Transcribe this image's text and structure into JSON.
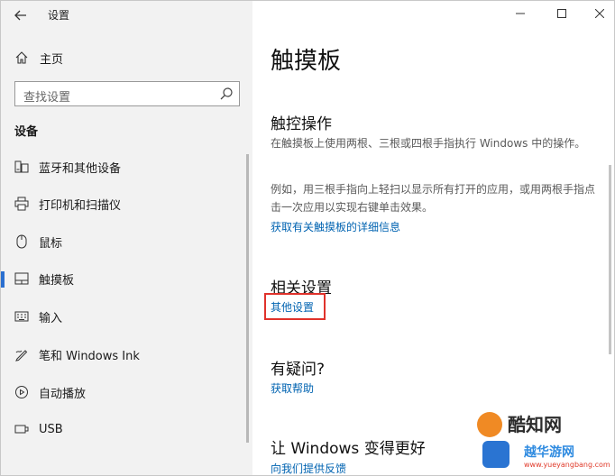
{
  "window": {
    "title": "设置"
  },
  "sidebar": {
    "home_label": "主页",
    "search_placeholder": "查找设置",
    "section_label": "设备",
    "items": [
      {
        "label": "蓝牙和其他设备",
        "icon": "bluetooth-devices-icon"
      },
      {
        "label": "打印机和扫描仪",
        "icon": "printer-icon"
      },
      {
        "label": "鼠标",
        "icon": "mouse-icon"
      },
      {
        "label": "触摸板",
        "icon": "touchpad-icon",
        "selected": true
      },
      {
        "label": "输入",
        "icon": "keyboard-icon"
      },
      {
        "label": "笔和 Windows Ink",
        "icon": "pen-icon"
      },
      {
        "label": "自动播放",
        "icon": "autoplay-icon"
      },
      {
        "label": "USB",
        "icon": "usb-icon"
      }
    ]
  },
  "main": {
    "title": "触摸板",
    "touch_section": {
      "heading": "触控操作",
      "desc1": "在触摸板上使用两根、三根或四根手指执行 Windows 中的操作。",
      "desc2": "例如，用三根手指向上轻扫以显示所有打开的应用，或用两根手指点击一次应用以实现右键单击效果。",
      "link": "获取有关触摸板的详细信息"
    },
    "related": {
      "heading": "相关设置",
      "link": "其他设置"
    },
    "question": {
      "heading": "有疑问?",
      "link": "获取帮助"
    },
    "improve": {
      "heading": "让 Windows 变得更好",
      "link": "向我们提供反馈"
    }
  },
  "watermark": {
    "line1": "酷知网",
    "line2": "越华游网",
    "line3": "www.yueyangbang.com"
  },
  "colors": {
    "accent": "#2a6fd0",
    "link": "#0063b1",
    "highlight": "#e0322b",
    "sidebar_bg": "#f2f2f2"
  }
}
